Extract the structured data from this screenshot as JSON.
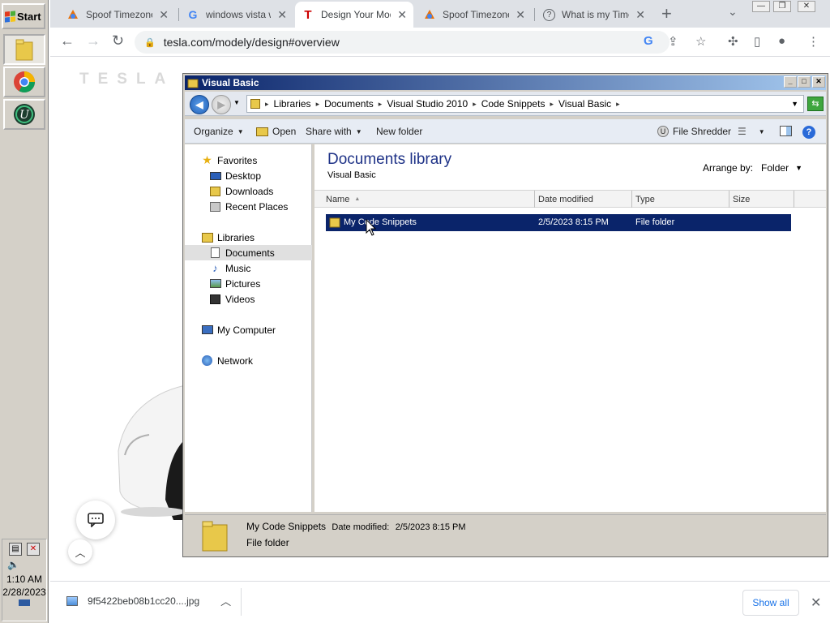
{
  "taskbar": {
    "start_label": "Start",
    "clock_time": "1:10 AM",
    "clock_date": "2/28/2023"
  },
  "browser": {
    "tabs": [
      {
        "label": "Spoof Timezone",
        "icon": "extension-shape-icon"
      },
      {
        "label": "windows vista wi",
        "icon": "google-g-icon"
      },
      {
        "label": "Design Your Mod",
        "icon": "tesla-t-icon",
        "active": true
      },
      {
        "label": "Spoof Timezone",
        "icon": "extension-shape-icon"
      },
      {
        "label": "What is my Time",
        "icon": "question-circle-icon"
      }
    ],
    "url": "tesla.com/modely/design#overview",
    "page": {
      "logo_text": "TESLA"
    },
    "download": {
      "filename": "9f5422beb08b1cc20....jpg",
      "show_all_label": "Show all"
    }
  },
  "explorer": {
    "title": "Visual Basic",
    "breadcrumb": [
      "Libraries",
      "Documents",
      "Visual Studio 2010",
      "Code Snippets",
      "Visual Basic"
    ],
    "commands": {
      "organize": "Organize",
      "open": "Open",
      "share_with": "Share with",
      "new_folder": "New folder",
      "file_shredder": "File Shredder"
    },
    "nav": {
      "favorites": "Favorites",
      "desktop": "Desktop",
      "downloads": "Downloads",
      "recent_places": "Recent Places",
      "libraries": "Libraries",
      "documents": "Documents",
      "music": "Music",
      "pictures": "Pictures",
      "videos": "Videos",
      "my_computer": "My Computer",
      "network": "Network"
    },
    "content": {
      "library_title": "Documents library",
      "library_subtitle": "Visual Basic",
      "arrange_by_label": "Arrange by:",
      "arrange_by_value": "Folder",
      "columns": [
        "Name",
        "Date modified",
        "Type",
        "Size"
      ],
      "rows": [
        {
          "name": "My Code Snippets",
          "date_modified": "2/5/2023 8:15 PM",
          "type": "File folder",
          "size": ""
        }
      ]
    },
    "details": {
      "name": "My Code Snippets",
      "date_label": "Date modified:",
      "date_value": "2/5/2023 8:15 PM",
      "type": "File folder"
    }
  },
  "colors": {
    "selection": "#0a246a",
    "titlebar_start": "#0a246a",
    "titlebar_end": "#a6caf0",
    "library_title": "#1e3287",
    "chrome_link": "#1a73e8"
  }
}
